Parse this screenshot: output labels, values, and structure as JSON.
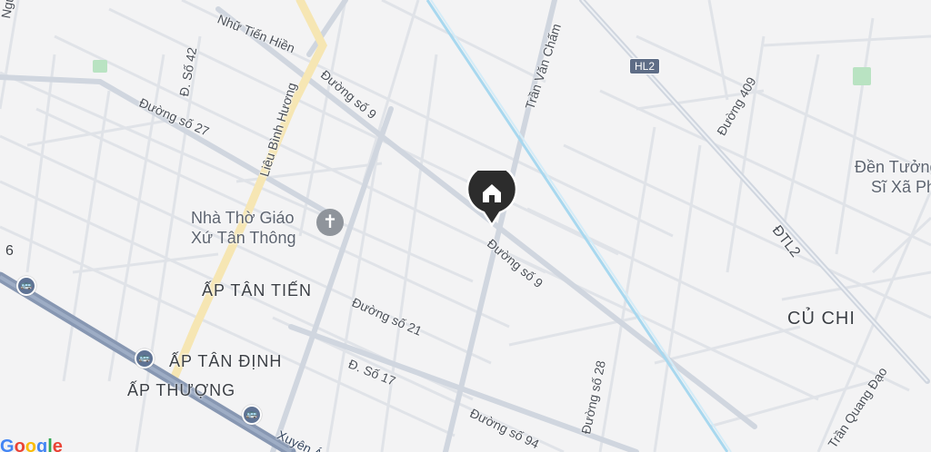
{
  "streets": {
    "nu_tien_hien": "Nhữ Tiến Hiền",
    "nguyen_partial": "Nguy",
    "d_so_42": "Đ. Số 42",
    "duong_so_27": "Đường số 27",
    "lieu_binh_huong": "Liêu Bình Hương",
    "duong_so_9_top": "Đường số 9",
    "tran_van_cham": "Trần Văn Chấm",
    "duong_409": "Đường 409",
    "dtl2": "ĐTL2",
    "duong_so_9_mid": "Đường số 9",
    "duong_so_21": "Đường số 21",
    "d_so_17": "Đ. Số 17",
    "duong_so_28": "Đường số 28",
    "duong_so_94": "Đường số 94",
    "tran_quang_dao": "Trần Quang Đạo",
    "xuyen_partial": "Xuyên Á"
  },
  "shield": {
    "hl2": "HL2"
  },
  "places": {
    "church_line1": "Nhà Thờ Giáo",
    "church_line2": "Xứ Tân Thông",
    "den_tuong_line1": "Đền Tưởng",
    "den_tuong_line2": "Sĩ Xã Ph",
    "ap_tan_tien": "ẤP TÂN TIẾN",
    "ap_tan_dinh": "ẤP TÂN ĐỊNH",
    "ap_thuong": "ẤP THƯỢNG",
    "cu_chi": "CỦ CHI",
    "edge_number": "6"
  },
  "attribution": "Google",
  "icons": {
    "pin": "home-pin-icon",
    "church": "cross-icon",
    "bus": "bus-stop-icon"
  },
  "colors": {
    "background": "#f3f3f4",
    "road_minor": "#dfe2e7",
    "road_major": "#d3d8e0",
    "road_yellow": "#f7e7b4",
    "highway": "#8797b2",
    "river": "#a8d8ef",
    "park": "#b9e3c2",
    "pin": "#2c2c2c"
  }
}
